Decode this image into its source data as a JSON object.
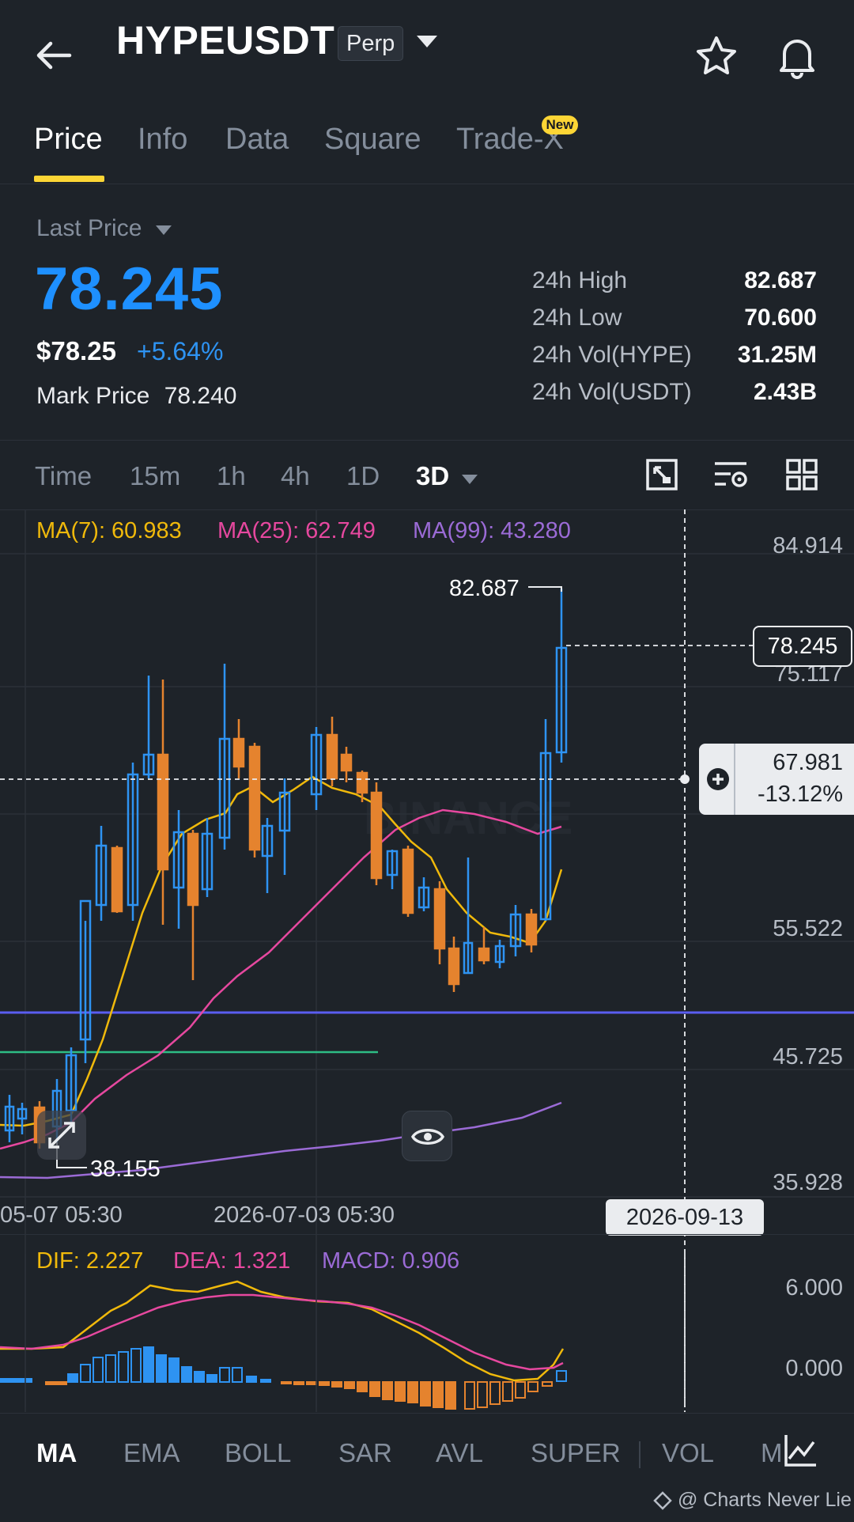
{
  "header": {
    "symbol": "HYPEUSDT",
    "contract_type": "Perp"
  },
  "tabs": [
    {
      "label": "Price"
    },
    {
      "label": "Info"
    },
    {
      "label": "Data"
    },
    {
      "label": "Square"
    },
    {
      "label": "Trade-X",
      "badge": "New"
    }
  ],
  "price": {
    "last_price_label": "Last Price",
    "last_price": "78.245",
    "usd_price": "$78.25",
    "change_pct": "+5.64%",
    "mark_price_label": "Mark Price",
    "mark_price": "78.240"
  },
  "stats": [
    {
      "label": "24h High",
      "value": "82.687"
    },
    {
      "label": "24h Low",
      "value": "70.600"
    },
    {
      "label": "24h Vol(HYPE)",
      "value": "31.25M"
    },
    {
      "label": "24h Vol(USDT)",
      "value": "2.43B"
    }
  ],
  "timeframes": [
    {
      "label": "Time"
    },
    {
      "label": "15m"
    },
    {
      "label": "1h"
    },
    {
      "label": "4h"
    },
    {
      "label": "1D"
    },
    {
      "label": "3D",
      "selected": true
    }
  ],
  "chart": {
    "ma_legend": [
      {
        "label": "MA(7): 60.983",
        "color": "#f0b90b"
      },
      {
        "label": "MA(25): 62.749",
        "color": "#e6489f"
      },
      {
        "label": "MA(99): 43.280",
        "color": "#9b6bd6"
      }
    ],
    "y_axis": [
      "84.914",
      "75.117",
      "55.522",
      "45.725",
      "35.928"
    ],
    "current_price_tag": "78.245",
    "high_label": "82.687",
    "low_label": "38.155",
    "crosshair_value": "67.981",
    "crosshair_pct": "-13.12%",
    "crosshair_date": "2026-09-13",
    "x_axis": [
      "05-07 05:30",
      "2026-07-03 05:30"
    ],
    "watermark": "BINANCE"
  },
  "macd": {
    "legend": [
      {
        "label": "DIF: 2.227",
        "color": "#f0b90b"
      },
      {
        "label": "DEA: 1.321",
        "color": "#e6489f"
      },
      {
        "label": "MACD: 0.906",
        "color": "#9b6bd6"
      }
    ],
    "y_axis": [
      "6.000",
      "0.000"
    ]
  },
  "indicator_tabs": [
    {
      "label": "MA",
      "active": true
    },
    {
      "label": "EMA"
    },
    {
      "label": "BOLL"
    },
    {
      "label": "SAR"
    },
    {
      "label": "AVL"
    },
    {
      "label": "SUPER"
    },
    {
      "label": "VOL"
    },
    {
      "label": "M"
    }
  ],
  "watermark_credit": "@ Charts Never Lie",
  "colors": {
    "up": "#2e93f2",
    "down": "#e5832e",
    "accent": "#fcd535",
    "price_blue": "#1e90ff"
  }
}
